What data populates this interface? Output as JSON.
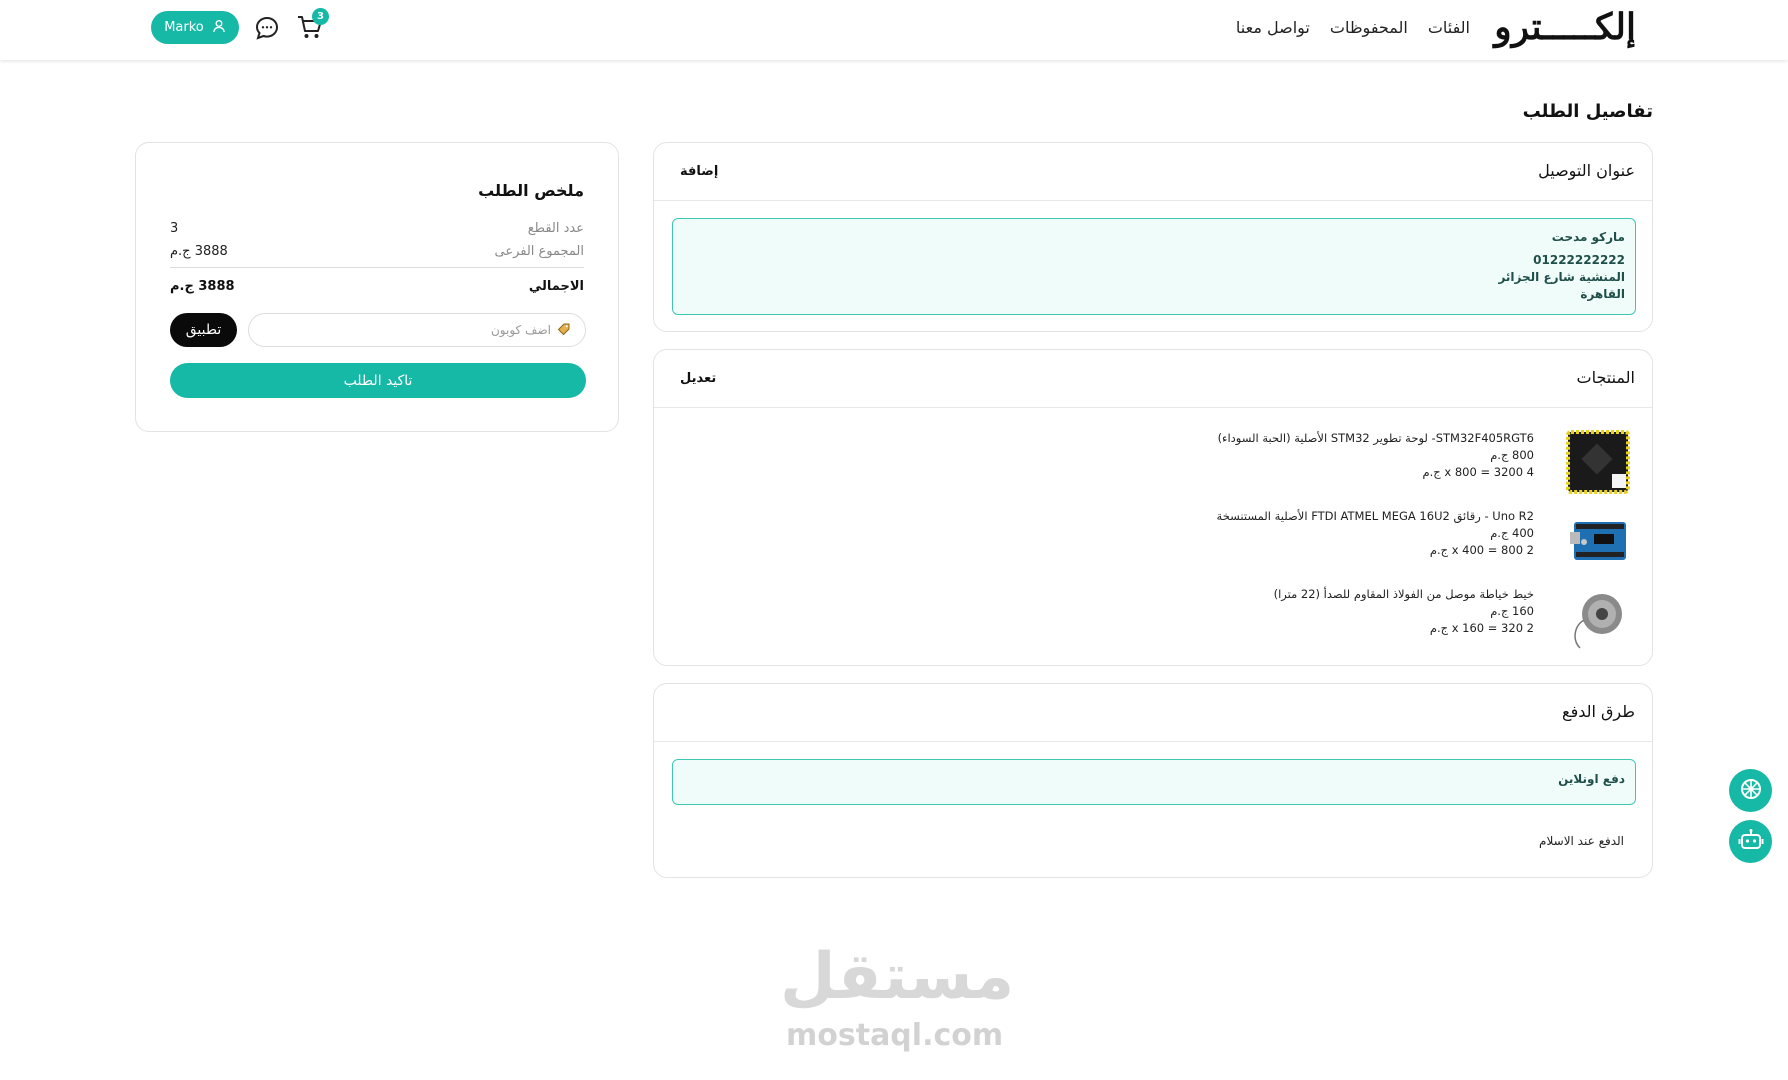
{
  "header": {
    "logo": "إلكـــــترو",
    "nav": [
      "الفئات",
      "المحفوظات",
      "تواصل معنا"
    ],
    "user_name": "Marko",
    "cart_count": "3"
  },
  "page_title": "تفاصيل الطلب",
  "address": {
    "title": "عنوان التوصيل",
    "action": "إضافة",
    "name": "ماركو مدحت",
    "phone": "01222222222",
    "street": "المنشية شارع الجزائر",
    "city": "القاهرة"
  },
  "products": {
    "title": "المنتجات",
    "action": "تعديل",
    "items": [
      {
        "name": "STM32F405RGT6- لوحة تطوير STM32 الأصلية (الحبة السوداء)",
        "price": "800 ج.م",
        "line": "4 x 800 = 3200 ج.م"
      },
      {
        "name": "Uno R2 - رقائق FTDI ATMEL MEGA 16U2 الأصلية المستنسخة",
        "price": "400 ج.م",
        "line": "2 x 400 = 800 ج.م"
      },
      {
        "name": "خيط خياطة موصل من الفولاذ المقاوم للصدأ (22 مترا)",
        "price": "160 ج.م",
        "line": "2 x 160 = 320 ج.م"
      }
    ]
  },
  "payment": {
    "title": "طرق الدفع",
    "online": "دفع اونلاين",
    "cod": "الدفع عند الاسلام"
  },
  "summary": {
    "title": "ملخص الطلب",
    "count_label": "عدد القطع",
    "count_value": "3",
    "subtotal_label": "المجموع الفرعى",
    "subtotal_value": "3888 ج.م",
    "total_label": "الاجمالي",
    "total_value": "3888 ج.م",
    "coupon_placeholder": "اضف كوبون",
    "apply": "تطبيق",
    "confirm": "تاكيد الطلب"
  },
  "watermark": {
    "ar": "مستقل",
    "en": "mostaql.com"
  },
  "colors": {
    "accent": "#16b8a6",
    "accent_light": "#f0fcfa",
    "dark": "#0a0a0a"
  }
}
